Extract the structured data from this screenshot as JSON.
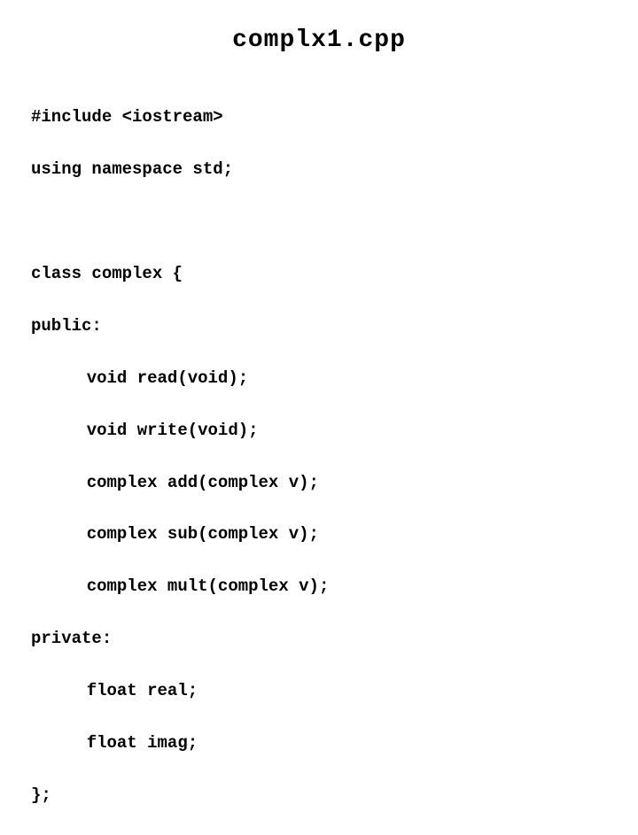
{
  "title": "complx1.cpp",
  "code": {
    "line1": "#include <iostream>",
    "line2": "using namespace std;",
    "line3": "class complex {",
    "line4": "public:",
    "line5": "void read(void);",
    "line6": "void write(void);",
    "line7": "complex add(complex v);",
    "line8": "complex sub(complex v);",
    "line9": "complex mult(complex v);",
    "line10": "private:",
    "line11": "float real;",
    "line12": "float imag;",
    "line13": "};"
  }
}
